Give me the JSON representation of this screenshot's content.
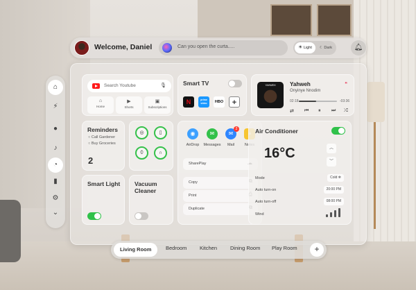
{
  "header": {
    "welcome": "Welcome, Daniel",
    "assistant_text": "Can you open the curta.....",
    "theme_light": "Light",
    "theme_dark": "Dark"
  },
  "sidebar": {
    "icons": [
      "home-icon",
      "lightning-icon",
      "droplet-icon",
      "bell-icon",
      "pie-chart-icon",
      "camera-icon",
      "gear-icon",
      "chevron-down-icon"
    ],
    "selected": [
      "home-icon",
      "pie-chart-icon"
    ]
  },
  "youtube": {
    "placeholder": "Search Youtube",
    "buttons": [
      {
        "label": "Home",
        "icon": "home-icon"
      },
      {
        "label": "Shorts",
        "icon": "shorts-icon"
      },
      {
        "label": "Subscriptions",
        "icon": "subscriptions-icon"
      }
    ]
  },
  "smart_tv": {
    "title": "Smart TV",
    "enabled": false,
    "apps": [
      {
        "label": "N",
        "bg": "#111111",
        "fg": "#e50914"
      },
      {
        "label": "prime video",
        "bg": "#1a98ff",
        "fg": "#ffffff"
      },
      {
        "label": "HBO",
        "bg": "#ffffff",
        "fg": "#111111"
      },
      {
        "label": "+",
        "bg": "#ffffff",
        "fg": "#333333"
      }
    ]
  },
  "music": {
    "album_text": "YAHWEH",
    "title": "Yahweh",
    "artist": "Onyinye Nnodim",
    "elapsed": "02:18",
    "remaining": "-03:36",
    "progress": 0.45
  },
  "reminders": {
    "title": "Reminders",
    "items": [
      "Call Gardener",
      "Buy Groceries"
    ],
    "count": "2"
  },
  "devices": {
    "icons": [
      "vr-headset-icon",
      "phone-icon",
      "watch-icon",
      "earbuds-icon"
    ]
  },
  "smart_light": {
    "title": "Smart Light",
    "enabled": true
  },
  "vacuum": {
    "title": "Vacuum Cleaner",
    "enabled": false
  },
  "share": {
    "apps": [
      {
        "label": "AirDrop",
        "icon": "airdrop-icon",
        "color": "#3da0ff"
      },
      {
        "label": "Messages",
        "icon": "messages-icon",
        "color": "#33c14a"
      },
      {
        "label": "Mail",
        "icon": "mail-icon",
        "color": "#2f86ff"
      },
      {
        "label": "Notes",
        "icon": "notes-icon",
        "color": "#f7c530"
      }
    ],
    "mail_badge": "2",
    "shareplay": "SharePlay",
    "actions": [
      "Copy",
      "Print",
      "Duplicate"
    ]
  },
  "air_conditioner": {
    "title": "Air Conditioner",
    "enabled": true,
    "temperature": "16°C",
    "rows": [
      {
        "label": "Mode",
        "value": "Cold ❄"
      },
      {
        "label": "Auto turn-on",
        "value": "20:00 PM"
      },
      {
        "label": "Auto turn-off",
        "value": "08:00 PM"
      },
      {
        "label": "Wind",
        "value": ""
      }
    ],
    "wind_level": 4
  },
  "rooms": {
    "items": [
      "Living Room",
      "Bedroom",
      "Kitchen",
      "Dining Room",
      "Play Room"
    ],
    "active": "Living Room"
  }
}
